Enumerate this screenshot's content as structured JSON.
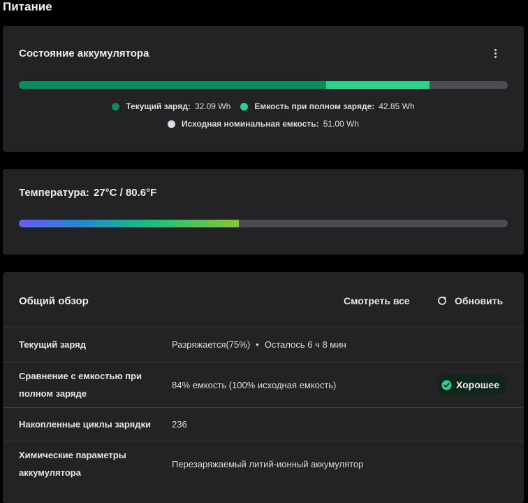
{
  "page": {
    "title": "Питание"
  },
  "battery": {
    "title": "Состояние аккумулятора",
    "more_icon": "more-vertical-icon",
    "current_charge_fraction_of_design": 0.629,
    "full_charge_fraction_of_design": 0.84,
    "legend": [
      {
        "label": "Текущий заряд:",
        "value": "32.09 Wh",
        "color": "#0e8a5c"
      },
      {
        "label": "Емкость при полном заряде:",
        "value": "42.85 Wh",
        "color": "#2ecf8c"
      },
      {
        "label": "Исходная номинальная емкость:",
        "value": "51.00 Wh",
        "color": "#d8dde4"
      }
    ]
  },
  "temperature": {
    "label": "Температура:",
    "value": "27°C / 80.6°F",
    "level_fraction": 0.45
  },
  "overview": {
    "title": "Общий обзор",
    "view_all_label": "Смотреть все",
    "refresh_label": "Обновить",
    "refresh_icon": "refresh-icon",
    "rows": [
      {
        "label": "Текущий заряд",
        "value": "Разряжается(75%)",
        "extra": "Осталось 6 ч 8 мин"
      },
      {
        "label": "Сравнение с емкостью при полном заряде",
        "value": "84% емкость (100% исходная емкость)",
        "badge": "Хорошее"
      },
      {
        "label": "Накопленные циклы зарядки",
        "value": "236"
      },
      {
        "label": "Химические параметры аккумулятора",
        "value": "Перезаряжаемый литий-ионный аккумулятор"
      }
    ]
  }
}
